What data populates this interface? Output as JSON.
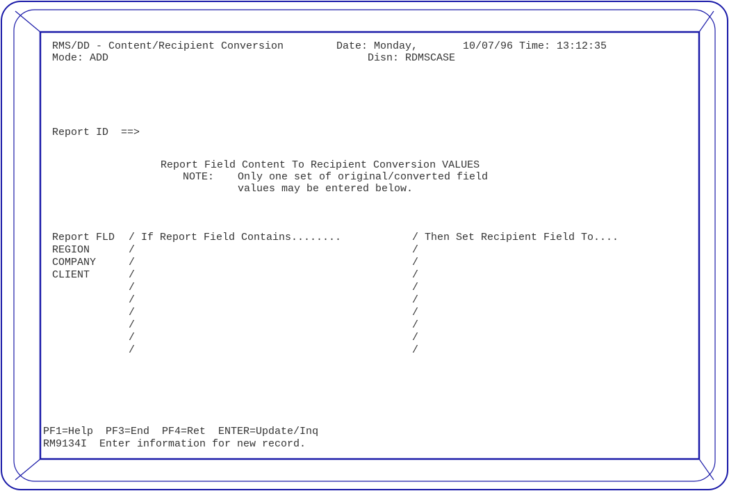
{
  "header": {
    "title": "RMS/DD - Content/Recipient Conversion",
    "date_label": "Date:",
    "date_day": "Monday,",
    "date_value": "10/07/96",
    "time_label": "Time:",
    "time_value": "13:12:35",
    "mode_label": "Mode:",
    "mode_value": "ADD",
    "disn_label": "Disn:",
    "disn_value": "RDMSCASE"
  },
  "report_id": {
    "label": "Report ID",
    "arrow": "==>",
    "value": ""
  },
  "heading": {
    "line1": "Report Field Content To Recipient Conversion VALUES",
    "note_label": "NOTE:",
    "line2": "Only one set of original/converted field",
    "line3": "values may be entered below."
  },
  "table": {
    "col_field": "Report FLD",
    "col_contains": "If Report Field Contains........",
    "col_set": "Then Set Recipient Field To....",
    "separator": "/",
    "rows": [
      {
        "field": "REGION",
        "contains": "",
        "set_to": ""
      },
      {
        "field": "COMPANY",
        "contains": "",
        "set_to": ""
      },
      {
        "field": "CLIENT",
        "contains": "",
        "set_to": ""
      },
      {
        "field": "",
        "contains": "",
        "set_to": ""
      },
      {
        "field": "",
        "contains": "",
        "set_to": ""
      },
      {
        "field": "",
        "contains": "",
        "set_to": ""
      },
      {
        "field": "",
        "contains": "",
        "set_to": ""
      },
      {
        "field": "",
        "contains": "",
        "set_to": ""
      },
      {
        "field": "",
        "contains": "",
        "set_to": ""
      }
    ]
  },
  "footer": {
    "pf_keys": "PF1=Help  PF3=End  PF4=Ret  ENTER=Update/Inq",
    "message": "RM9134I  Enter information for new record."
  },
  "colors": {
    "frame": "#1a1aa8",
    "text": "#333333",
    "background": "#ffffff"
  }
}
